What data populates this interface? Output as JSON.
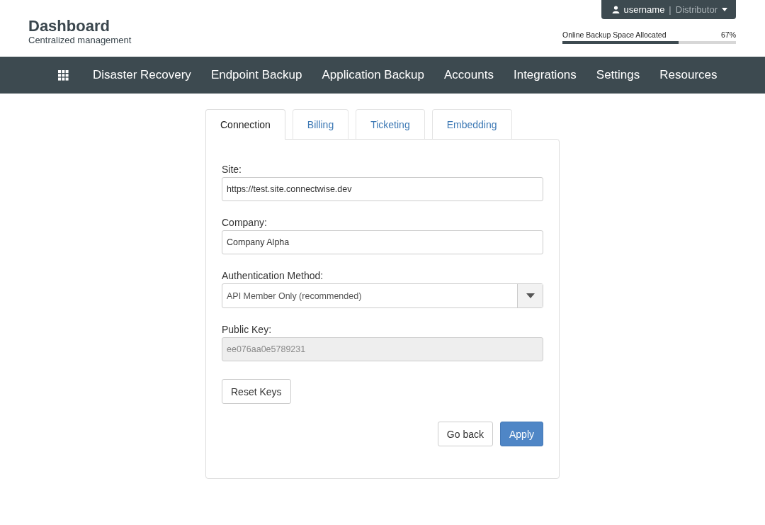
{
  "header": {
    "title": "Dashboard",
    "subtitle": "Centralized management",
    "user": {
      "name": "username",
      "separator": "|",
      "role": "Distributor"
    },
    "storage": {
      "label": "Online Backup Space Allocated",
      "reading": "67%",
      "level": 0.67
    }
  },
  "nav": [
    "Disaster Recovery",
    "Endpoint Backup",
    "Application Backup",
    "Accounts",
    "Integrations",
    "Settings",
    "Resources"
  ],
  "tabs": [
    {
      "label": "Connection",
      "selected": true
    },
    {
      "label": "Billing",
      "selected": false
    },
    {
      "label": "Ticketing",
      "selected": false
    },
    {
      "label": "Embedding",
      "selected": false
    }
  ],
  "fields": [
    {
      "kind": "text",
      "label": "Site:",
      "value": "https://test.site.connectwise.dev",
      "disabled": false
    },
    {
      "kind": "text",
      "label": "Company:",
      "value": "Company Alpha",
      "disabled": false
    },
    {
      "kind": "select",
      "label": "Authentication Method:",
      "value": "API Member Only (recommended)",
      "disabled": false
    },
    {
      "kind": "text",
      "label": "Public Key:",
      "value": "ee076aa0e5789231",
      "disabled": true
    }
  ],
  "reset_button": "Reset Keys",
  "actions": [
    {
      "label": "Go back",
      "kind": "default"
    },
    {
      "label": "Apply",
      "kind": "primary"
    }
  ]
}
